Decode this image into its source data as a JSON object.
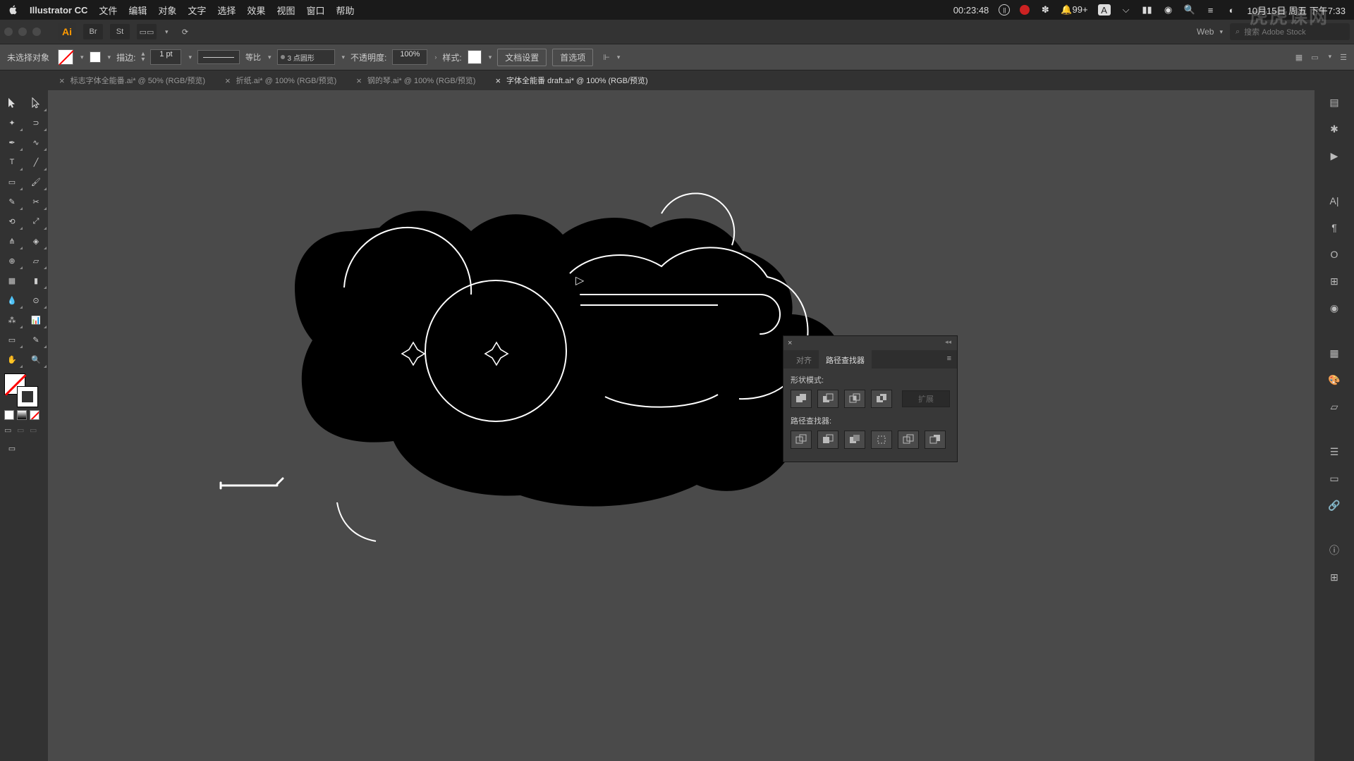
{
  "menubar": {
    "app": "Illustrator CC",
    "items": [
      "文件",
      "编辑",
      "对象",
      "文字",
      "选择",
      "效果",
      "视图",
      "窗口",
      "帮助"
    ],
    "timer": "00:23:48",
    "notif_count": "99+",
    "input_badge": "A",
    "date": "10月15日 周五 下午7:33"
  },
  "header": {
    "profile": "Web",
    "search_placeholder": "搜索 Adobe Stock"
  },
  "control": {
    "selection_status": "未选择对象",
    "stroke_label": "描边:",
    "stroke_weight": "1 pt",
    "ratio_label": "等比",
    "corner_profile": "3 点圆形",
    "opacity_label": "不透明度:",
    "opacity_value": "100%",
    "style_label": "样式:",
    "doc_setup": "文档设置",
    "prefs": "首选项"
  },
  "tabs": [
    {
      "label": "标志字体全能番.ai* @ 50% (RGB/预览)",
      "active": false
    },
    {
      "label": "折纸.ai* @ 100% (RGB/预览)",
      "active": false
    },
    {
      "label": "钢的琴.ai* @ 100% (RGB/预览)",
      "active": false
    },
    {
      "label": "字体全能番 draft.ai* @ 100% (RGB/预览)",
      "active": true
    }
  ],
  "pathfinder": {
    "tab_align": "对齐",
    "tab_pf": "路径查找器",
    "shape_modes": "形状模式:",
    "pathfinders": "路径查找器:",
    "expand": "扩展"
  },
  "watermark": "虎虎课网"
}
